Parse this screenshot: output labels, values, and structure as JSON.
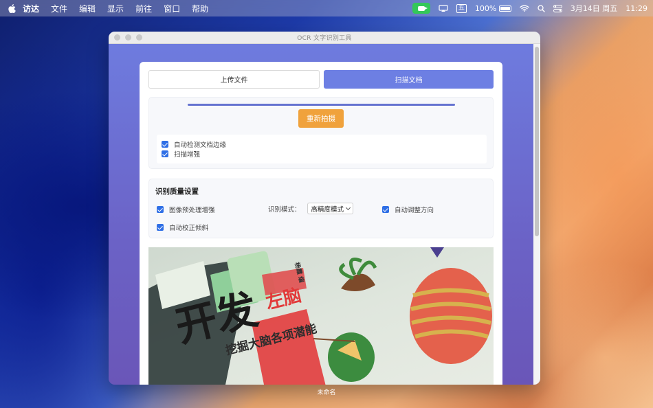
{
  "menubar": {
    "app_name": "访达",
    "menus": [
      "文件",
      "编辑",
      "显示",
      "前往",
      "窗口",
      "帮助"
    ],
    "ime": "五",
    "battery": "100%",
    "date": "3月14日 周五",
    "time": "11:29"
  },
  "window": {
    "title": "OCR 文字识别工具"
  },
  "tabs": {
    "upload": "上传文件",
    "scan": "扫描文档",
    "active": "scan"
  },
  "scan": {
    "progress": 1.0,
    "rescan_label": "重新拍摄",
    "options": [
      {
        "label": "自动检测文档边缘",
        "checked": true
      },
      {
        "label": "扫描增强",
        "checked": true
      }
    ]
  },
  "quality": {
    "title": "识别质量设置",
    "preprocess_label": "图像预处理增强",
    "mode_label": "识别模式：",
    "mode_value": "高精度模式",
    "auto_orient_label": "自动调整方向",
    "deskew_label": "自动校正倾斜"
  },
  "photo": {
    "text_main": "开发",
    "text_sub": "挖掘大脑各项潜能",
    "text_left": "左脑",
    "text_author": "杨霞  编"
  },
  "desktop": {
    "folder_label": "未命名"
  }
}
